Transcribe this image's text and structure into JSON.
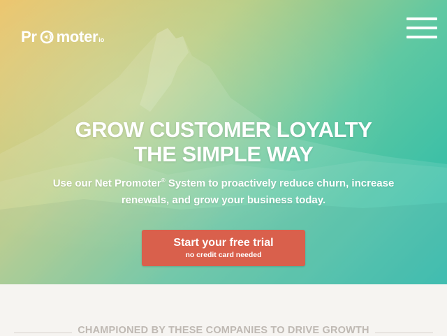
{
  "brand": {
    "logo_prefix": "Pr",
    "logo_suffix": "moter",
    "logo_tld": "io",
    "colors": {
      "accent": "#d9604c",
      "hero_start": "#ecc46a",
      "hero_end": "#20b9aa",
      "page_bg": "#f6f4f1"
    }
  },
  "nav": {
    "menu_icon": "hamburger-icon"
  },
  "hero": {
    "headline_line1": "GROW CUSTOMER LOYALTY",
    "headline_line2": "THE SIMPLE WAY",
    "sub_part1": "Use our Net Promoter",
    "sub_reg": "®",
    "sub_part2": " System to proactively reduce churn, increase renewals, and grow your business today.",
    "cta_label": "Start your free trial",
    "cta_sublabel": "no credit card needed"
  },
  "customers": {
    "heading": "CHAMPIONED BY THESE COMPANIES TO DRIVE GROWTH"
  }
}
